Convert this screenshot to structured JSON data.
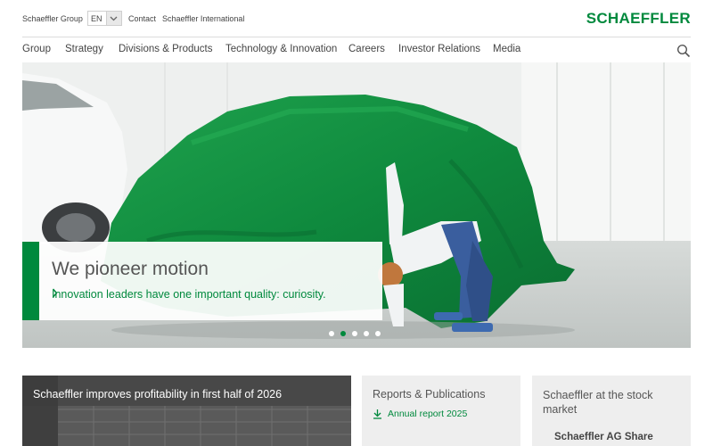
{
  "topbar": {
    "group_link": "Schaeffler Group",
    "language": "EN",
    "contact_link": "Contact",
    "international_link": "Schaeffler International",
    "logo_text": "SCHAEFFLER"
  },
  "nav": {
    "items": [
      "Group",
      "Strategy",
      "Divisions & Products",
      "Technology & Innovation",
      "Careers",
      "Investor Relations",
      "Media"
    ]
  },
  "hero": {
    "title": "We pioneer motion",
    "subtitle": "Innovation leaders have one important quality: curiosity.",
    "slide_count": 5,
    "active_slide": 2
  },
  "cards": {
    "news_title": "Schaeffler improves profitability in first half of 2026",
    "reports_title": "Reports & Publications",
    "reports_link": "Annual report 2025",
    "stock_title": "Schaeffler at the stock market",
    "stock_share": "Schaeffler AG Share"
  },
  "colors": {
    "brand_green": "#00893d",
    "text_gray": "#444444",
    "card_bg": "#eeeeee"
  },
  "icons": {
    "search": "search-icon",
    "language_dropdown": "chevron-down-icon",
    "hero_link": "chevron-right-icon",
    "download": "download-icon"
  }
}
